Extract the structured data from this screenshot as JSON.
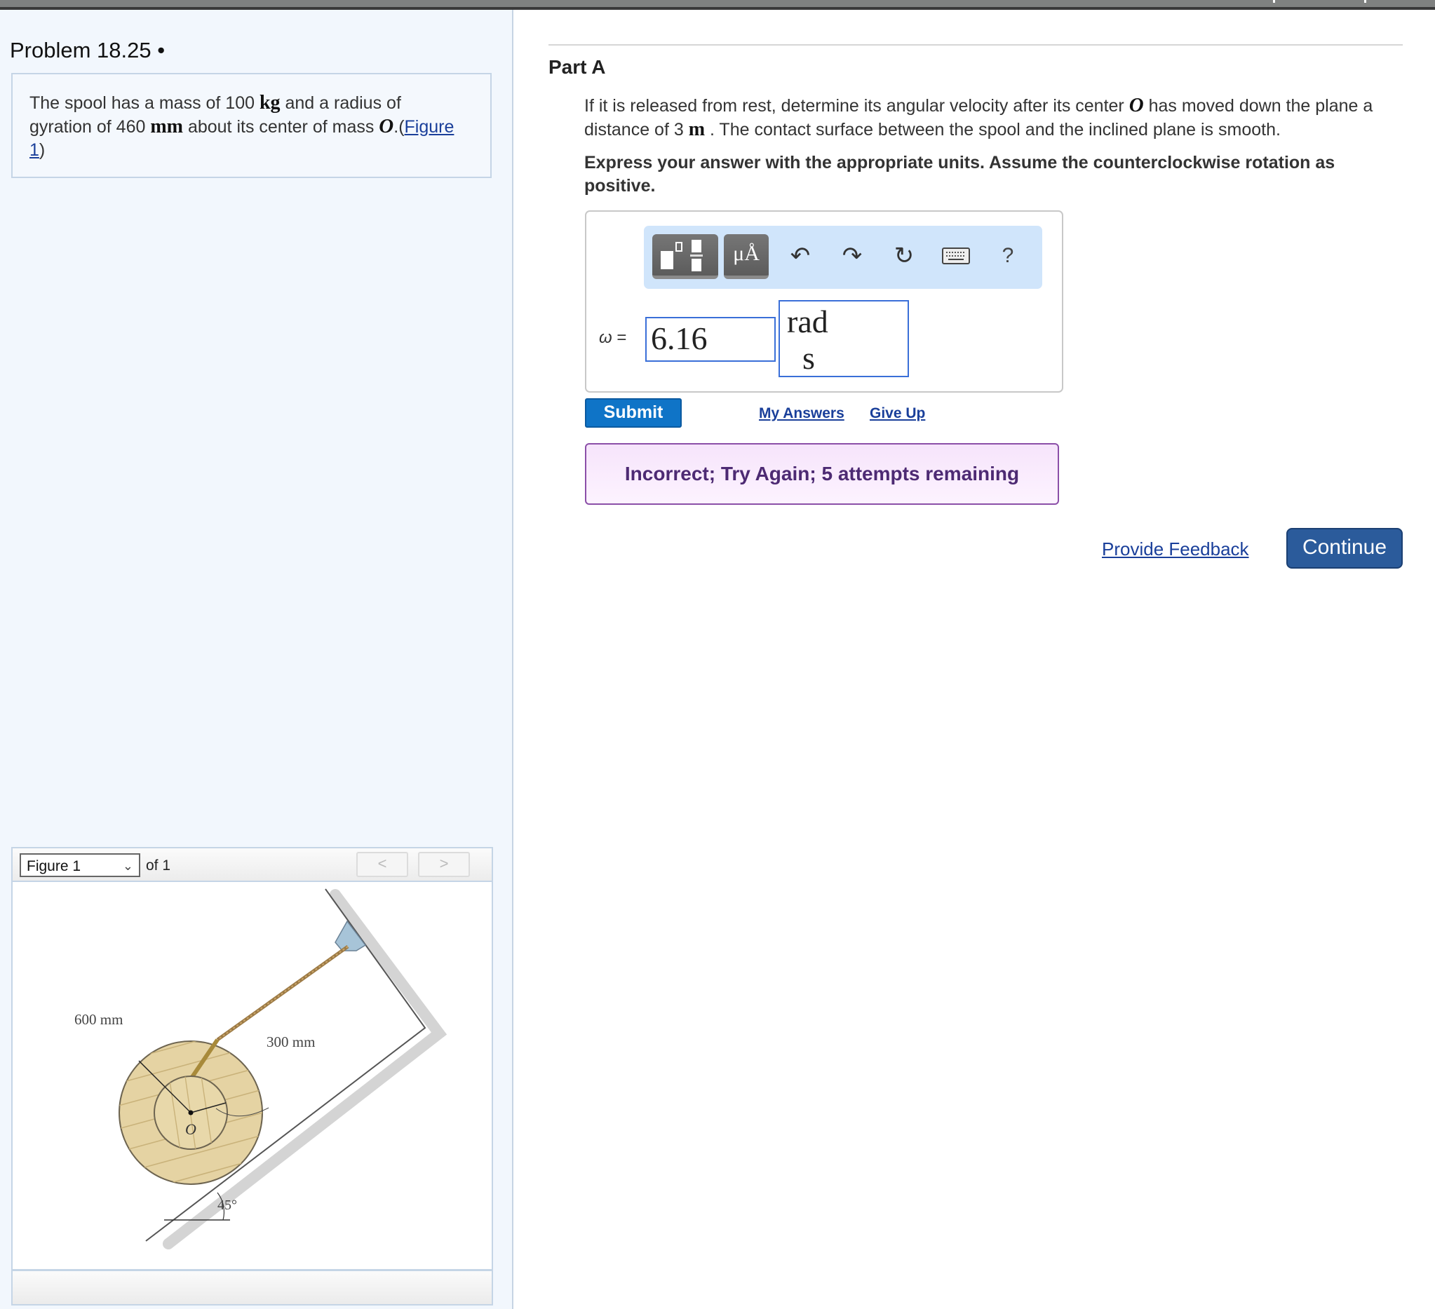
{
  "problem": {
    "title": "Problem 18.25 •",
    "text_parts": {
      "p1": "The spool has a mass of 100 ",
      "u1": "kg",
      "p2": " and a radius of gyration of 460 ",
      "u2": "mm",
      "p3": " about its center of mass ",
      "sym": "O",
      "p4": ".(",
      "link": "Figure 1",
      "p5": ")"
    }
  },
  "figure_viewer": {
    "selected": "Figure 1",
    "of_label": "of 1",
    "prev_icon": "<",
    "next_icon": ">",
    "labels": {
      "outer": "600 mm",
      "inner": "300 mm",
      "center": "O",
      "angle": "45°"
    }
  },
  "part": {
    "title": "Part A",
    "question": {
      "p1": "If it is released from rest, determine its angular velocity after its center ",
      "sym": "O",
      "p2": " has moved down the plane a distance of 3 ",
      "unit": "m",
      "p3": " . The contact surface between the spool and the inclined plane is smooth."
    },
    "instruction": "Express your answer with the appropriate units. Assume the counterclockwise rotation as positive."
  },
  "answer": {
    "toolbar": {
      "templates_icon": "templates-icon",
      "units_label": "μÅ",
      "undo_icon": "↶",
      "redo_icon": "↷",
      "reset_icon": "↻",
      "keyboard_icon": "keyboard-icon",
      "help_label": "?"
    },
    "variable_label": "ω",
    "equals": "=",
    "value": "6.16",
    "unit_numerator": "rad",
    "unit_denominator": "s"
  },
  "actions": {
    "submit": "Submit",
    "my_answers": "My Answers",
    "give_up": "Give Up"
  },
  "feedback": {
    "message": "Incorrect; Try Again; 5 attempts remaining",
    "color": "#4d2a73"
  },
  "footer": {
    "provide_feedback": "Provide Feedback",
    "continue": "Continue"
  }
}
